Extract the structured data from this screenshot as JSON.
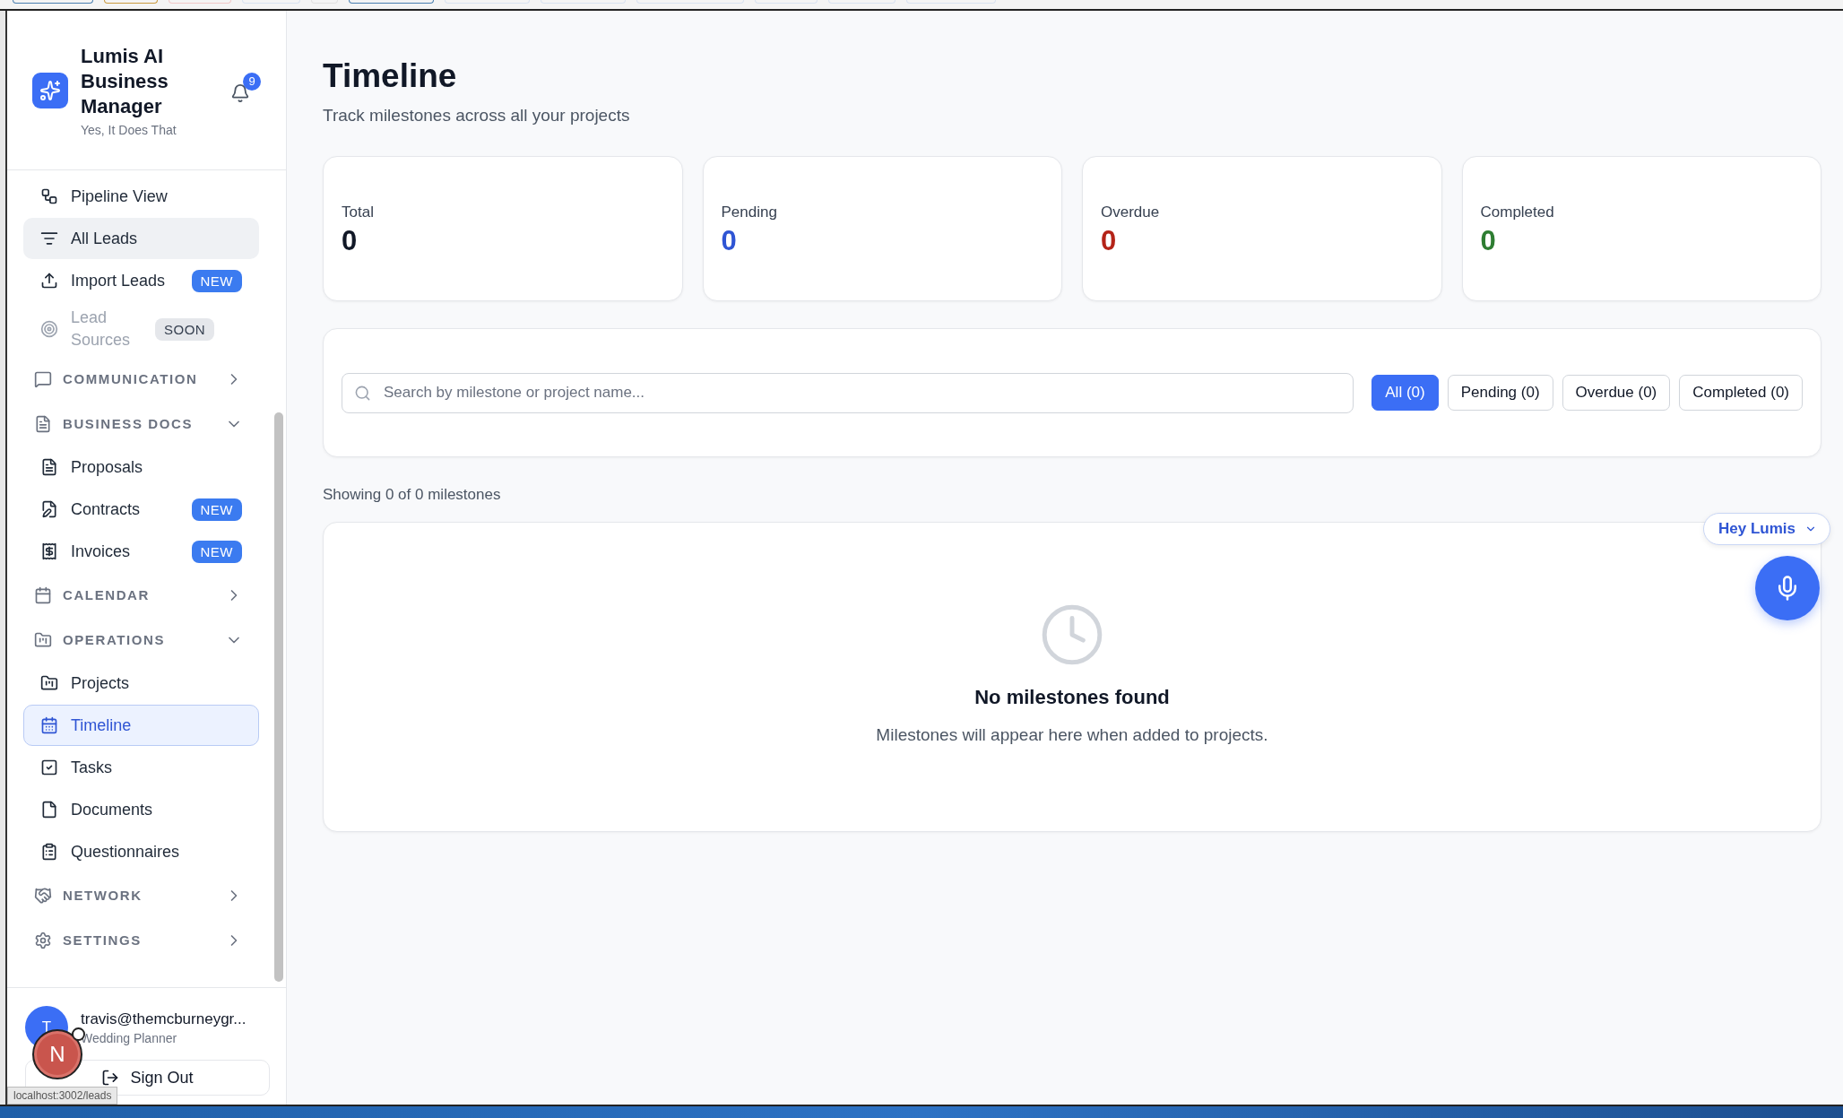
{
  "app": {
    "name": "Lumis AI Business Manager",
    "tagline": "Yes, It Does That",
    "notification_count": "9"
  },
  "nav": [
    {
      "kind": "item",
      "label": "Pipeline View",
      "selected": false,
      "highlighted": false,
      "disabled": false
    },
    {
      "kind": "item",
      "label": "All Leads",
      "selected": false,
      "highlighted": true,
      "disabled": false
    },
    {
      "kind": "item",
      "label": "Import Leads",
      "selected": false,
      "highlighted": false,
      "disabled": false,
      "badge": "NEW"
    },
    {
      "kind": "item",
      "label": "Lead Sources",
      "selected": false,
      "highlighted": false,
      "disabled": true,
      "badge": "SOON"
    },
    {
      "kind": "section",
      "label": "COMMUNICATION",
      "expanded": false
    },
    {
      "kind": "section",
      "label": "BUSINESS DOCS",
      "expanded": true,
      "children": [
        {
          "label": "Proposals",
          "selected": false
        },
        {
          "label": "Contracts",
          "selected": false,
          "badge": "NEW"
        },
        {
          "label": "Invoices",
          "selected": false,
          "badge": "NEW"
        }
      ]
    },
    {
      "kind": "section",
      "label": "CALENDAR",
      "expanded": false
    },
    {
      "kind": "section",
      "label": "OPERATIONS",
      "expanded": true,
      "children": [
        {
          "label": "Projects",
          "selected": false
        },
        {
          "label": "Timeline",
          "selected": true
        },
        {
          "label": "Tasks",
          "selected": false
        },
        {
          "label": "Documents",
          "selected": false
        },
        {
          "label": "Questionnaires",
          "selected": false
        }
      ]
    },
    {
      "kind": "section",
      "label": "NETWORK",
      "expanded": false
    },
    {
      "kind": "section",
      "label": "SETTINGS",
      "expanded": false
    }
  ],
  "user": {
    "initial": "T",
    "email": "travis@themcburneygr...",
    "role": "Wedding Planner",
    "sign_out": "Sign Out"
  },
  "page": {
    "title": "Timeline",
    "subtitle": "Track milestones across all your projects"
  },
  "stats": [
    {
      "label": "Total",
      "value": "0",
      "color": "#111827"
    },
    {
      "label": "Pending",
      "value": "0",
      "color": "#2f55d4"
    },
    {
      "label": "Overdue",
      "value": "0",
      "color": "#b42318"
    },
    {
      "label": "Completed",
      "value": "0",
      "color": "#2e7d32"
    }
  ],
  "search": {
    "placeholder": "Search by milestone or project name..."
  },
  "filters": [
    {
      "label": "All (0)",
      "selected": true
    },
    {
      "label": "Pending (0)",
      "selected": false
    },
    {
      "label": "Overdue (0)",
      "selected": false
    },
    {
      "label": "Completed (0)",
      "selected": false
    }
  ],
  "showing": "Showing 0 of 0 milestones",
  "empty": {
    "title": "No milestones found",
    "message": "Milestones will appear here when added to projects."
  },
  "assistant": {
    "label": "Hey Lumis"
  },
  "dev_indicator": {
    "letter": "N"
  },
  "status_url": "localhost:3002/leads"
}
